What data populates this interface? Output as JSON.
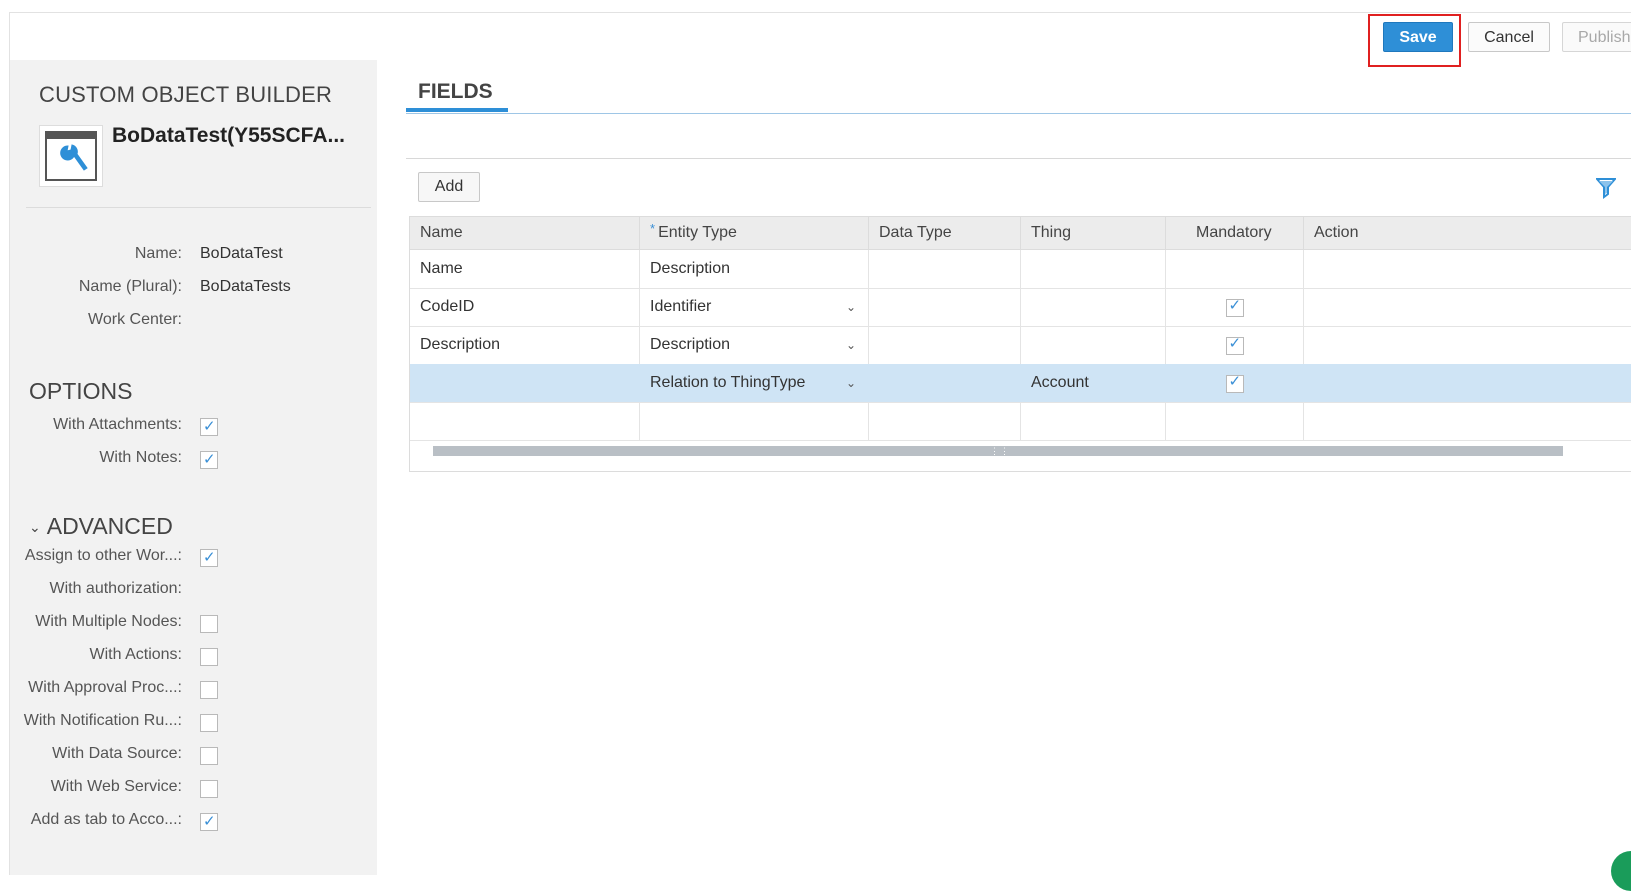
{
  "toolbar": {
    "save_label": "Save",
    "cancel_label": "Cancel",
    "publish_label": "Publish"
  },
  "sidebar": {
    "title": "CUSTOM OBJECT BUILDER",
    "object_name": "BoDataTest(Y55SCFA...",
    "fields": [
      {
        "label": "Name:",
        "value": "BoDataTest"
      },
      {
        "label": "Name (Plural):",
        "value": "BoDataTests"
      },
      {
        "label": "Work Center:",
        "value": ""
      }
    ],
    "options_title": "OPTIONS",
    "options": [
      {
        "label": "With Attachments:",
        "checked": true
      },
      {
        "label": "With Notes:",
        "checked": true
      }
    ],
    "advanced_title": "ADVANCED",
    "advanced": [
      {
        "label": "Assign to other Wor...:",
        "checked": true,
        "has_checkbox": true
      },
      {
        "label": "With authorization:",
        "checked": false,
        "has_checkbox": false
      },
      {
        "label": "With Multiple Nodes:",
        "checked": false,
        "has_checkbox": true
      },
      {
        "label": "With Actions:",
        "checked": false,
        "has_checkbox": true
      },
      {
        "label": "With Approval Proc...:",
        "checked": false,
        "has_checkbox": true
      },
      {
        "label": "With Notification Ru...:",
        "checked": false,
        "has_checkbox": true
      },
      {
        "label": "With Data Source:",
        "checked": false,
        "has_checkbox": true
      },
      {
        "label": "With Web Service:",
        "checked": false,
        "has_checkbox": true
      },
      {
        "label": "Add as tab to Acco...:",
        "checked": true,
        "has_checkbox": true
      }
    ]
  },
  "main": {
    "title": "FIELDS",
    "add_label": "Add",
    "columns": [
      "Name",
      "Entity Type",
      "Data Type",
      "Thing",
      "Mandatory",
      "Action"
    ],
    "rows": [
      {
        "name": "Name",
        "entity_type": "Description",
        "data_type": "",
        "thing": "",
        "mandatory": null,
        "dropdown": false,
        "selected": false
      },
      {
        "name": "CodeID",
        "entity_type": "Identifier",
        "data_type": "",
        "thing": "",
        "mandatory": true,
        "dropdown": true,
        "selected": false
      },
      {
        "name": "Description",
        "entity_type": "Description",
        "data_type": "",
        "thing": "",
        "mandatory": true,
        "dropdown": true,
        "selected": false
      },
      {
        "name": "",
        "entity_type": "Relation to ThingType",
        "data_type": "",
        "thing": "Account",
        "mandatory": true,
        "dropdown": true,
        "selected": true
      }
    ]
  },
  "icons": {
    "object": "object-builder-icon",
    "filter": "filter-icon",
    "dropdown": "chevron-down-icon",
    "advanced_toggle": "chevron-down-icon"
  },
  "colors": {
    "accent": "#2e8fd7",
    "highlight": "#e02020",
    "selected_row": "#cfe4f5",
    "sidebar_bg": "#f2f2f2"
  }
}
